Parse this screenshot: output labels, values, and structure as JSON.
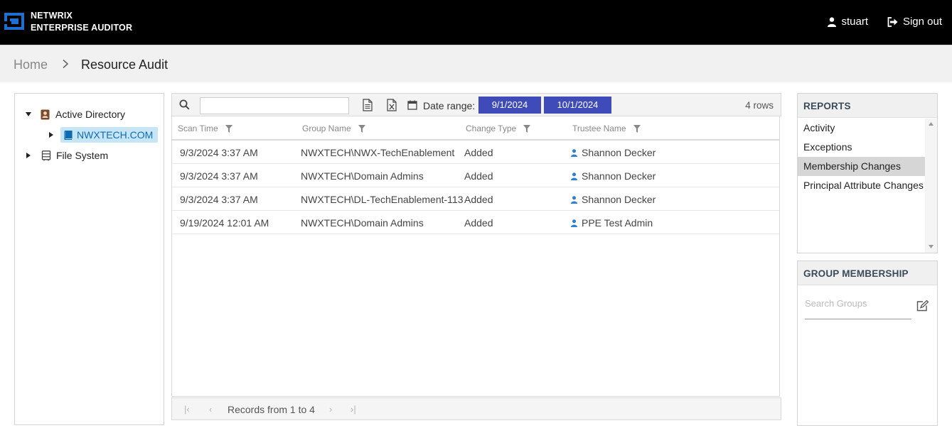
{
  "header": {
    "brand_line1": "NETWRIX",
    "brand_line2": "ENTERPRISE AUDITOR",
    "username": "stuart",
    "signout_label": "Sign out"
  },
  "breadcrumb": {
    "home": "Home",
    "current": "Resource Audit"
  },
  "tree": {
    "nodes": [
      {
        "label": "Active Directory",
        "expanded": true
      },
      {
        "label": "NWXTECH.COM",
        "selected": true
      },
      {
        "label": "File System",
        "expanded": false
      }
    ]
  },
  "toolbar": {
    "search_value": "",
    "date_range_label": "Date range:",
    "date_start": "9/1/2024",
    "date_end": "10/1/2024",
    "rows_count": "4 rows"
  },
  "table": {
    "columns": [
      "Scan Time",
      "Group Name",
      "Change Type",
      "Trustee Name"
    ],
    "rows": [
      {
        "scan_time": "9/3/2024 3:37 AM",
        "group_name": "NWXTECH\\NWX-TechEnablement",
        "change_type": "Added",
        "trustee": "Shannon Decker"
      },
      {
        "scan_time": "9/3/2024 3:37 AM",
        "group_name": "NWXTECH\\Domain Admins",
        "change_type": "Added",
        "trustee": "Shannon Decker"
      },
      {
        "scan_time": "9/3/2024 3:37 AM",
        "group_name": "NWXTECH\\DL-TechEnablement-113",
        "change_type": "Added",
        "trustee": "Shannon Decker"
      },
      {
        "scan_time": "9/19/2024 12:01 AM",
        "group_name": "NWXTECH\\Domain Admins",
        "change_type": "Added",
        "trustee": "PPE Test Admin"
      }
    ]
  },
  "pager": {
    "text": "Records from 1 to 4"
  },
  "reports": {
    "title": "REPORTS",
    "items": [
      {
        "label": "Activity",
        "selected": false
      },
      {
        "label": "Exceptions",
        "selected": false
      },
      {
        "label": "Membership Changes",
        "selected": true
      },
      {
        "label": "Principal Attribute Changes",
        "selected": false
      }
    ]
  },
  "group_membership": {
    "title": "GROUP MEMBERSHIP",
    "search_placeholder": "Search Groups"
  },
  "colors": {
    "accent": "#3f4bb8",
    "selected_tree_bg": "#c6e6f7",
    "selected_tree_text": "#0f6cb3",
    "user_icon": "#2f7fd1",
    "logo_blue": "#1f6fd1"
  }
}
